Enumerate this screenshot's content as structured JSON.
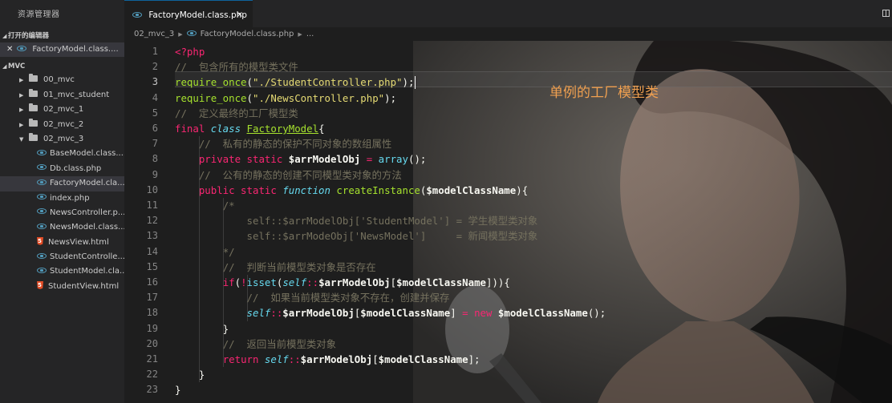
{
  "sidebar": {
    "title": "资源管理器",
    "open_editors": {
      "label": "打开的编辑器",
      "items": [
        {
          "name": "FactoryModel.class...."
        }
      ]
    },
    "workspace": {
      "label": "MVC",
      "folders": [
        {
          "name": "00_mvc"
        },
        {
          "name": "01_mvc_student"
        },
        {
          "name": "02_mvc_1"
        },
        {
          "name": "02_mvc_2"
        },
        {
          "name": "02_mvc_3"
        }
      ],
      "files": [
        {
          "name": "BaseModel.class....",
          "icon": "php-icon"
        },
        {
          "name": "Db.class.php",
          "icon": "php-icon"
        },
        {
          "name": "FactoryModel.cla...",
          "icon": "php-icon"
        },
        {
          "name": "index.php",
          "icon": "php-icon"
        },
        {
          "name": "NewsController.p...",
          "icon": "php-icon"
        },
        {
          "name": "NewsModel.class....",
          "icon": "php-icon"
        },
        {
          "name": "NewsView.html",
          "icon": "html-icon"
        },
        {
          "name": "StudentControlle...",
          "icon": "php-icon"
        },
        {
          "name": "StudentModel.cla...",
          "icon": "php-icon"
        },
        {
          "name": "StudentView.html",
          "icon": "html-icon"
        }
      ]
    }
  },
  "tab": {
    "label": "FactoryModel.class.php",
    "close": "×"
  },
  "breadcrumb": {
    "folder": "02_mvc_3",
    "file": "FactoryModel.class.php",
    "more": "..."
  },
  "annotation": "单例的工厂模型类",
  "line_numbers": [
    "1",
    "2",
    "3",
    "4",
    "5",
    "6",
    "7",
    "8",
    "9",
    "10",
    "11",
    "12",
    "13",
    "14",
    "15",
    "16",
    "17",
    "18",
    "19",
    "20",
    "21",
    "22",
    "23"
  ],
  "current_line": "3",
  "code_lines": [
    [
      {
        "c": "t-tag",
        "t": "<?php"
      }
    ],
    [
      {
        "c": "t-com",
        "t": "//  包含所有的模型类文件"
      }
    ],
    [
      {
        "c": "t-req",
        "t": "require_once"
      },
      {
        "c": "t-pun",
        "t": "("
      },
      {
        "c": "t-str",
        "t": "\"./StudentController.php\""
      },
      {
        "c": "t-pun",
        "t": ");"
      }
    ],
    [
      {
        "c": "t-req",
        "t": "require_once"
      },
      {
        "c": "t-pun",
        "t": "("
      },
      {
        "c": "t-str",
        "t": "\"./NewsController.php\""
      },
      {
        "c": "t-pun",
        "t": ");"
      }
    ],
    [
      {
        "c": "t-com",
        "t": "//  定义最终的工厂模型类"
      }
    ],
    [
      {
        "c": "t-kw",
        "t": "final "
      },
      {
        "c": "t-cls",
        "t": "class "
      },
      {
        "c": "t-def",
        "t": "FactoryModel"
      },
      {
        "c": "t-pun",
        "t": "{"
      }
    ],
    [
      {
        "c": "t-pun",
        "t": "    "
      },
      {
        "c": "t-com",
        "t": "//  私有的静态的保护不同对象的数组属性"
      }
    ],
    [
      {
        "c": "t-pun",
        "t": "    "
      },
      {
        "c": "t-kw",
        "t": "private static "
      },
      {
        "c": "t-var",
        "t": "$arrModelObj"
      },
      {
        "c": "t-op",
        "t": " = "
      },
      {
        "c": "t-blu",
        "t": "array"
      },
      {
        "c": "t-pun",
        "t": "();"
      }
    ],
    [
      {
        "c": "t-pun",
        "t": "    "
      },
      {
        "c": "t-com",
        "t": "//  公有的静态的创建不同模型类对象的方法"
      }
    ],
    [
      {
        "c": "t-pun",
        "t": "    "
      },
      {
        "c": "t-kw",
        "t": "public static "
      },
      {
        "c": "t-cls",
        "t": "function "
      },
      {
        "c": "t-fn",
        "t": "createInstance"
      },
      {
        "c": "t-pun",
        "t": "("
      },
      {
        "c": "t-var",
        "t": "$modelClassName"
      },
      {
        "c": "t-pun",
        "t": "){"
      }
    ],
    [
      {
        "c": "t-pun",
        "t": "        "
      },
      {
        "c": "t-com",
        "t": "/*"
      }
    ],
    [
      {
        "c": "t-pun",
        "t": "            "
      },
      {
        "c": "t-com",
        "t": "self::$arrModelObj['StudentModel'] = 学生模型类对象"
      }
    ],
    [
      {
        "c": "t-pun",
        "t": "            "
      },
      {
        "c": "t-com",
        "t": "self::$arrModeObj['NewsModel']     = 新闻模型类对象"
      }
    ],
    [
      {
        "c": "t-pun",
        "t": "        "
      },
      {
        "c": "t-com",
        "t": "*/"
      }
    ],
    [
      {
        "c": "t-pun",
        "t": "        "
      },
      {
        "c": "t-com",
        "t": "//  判断当前模型类对象是否存在"
      }
    ],
    [
      {
        "c": "t-pun",
        "t": "        "
      },
      {
        "c": "t-kw",
        "t": "if"
      },
      {
        "c": "t-pun",
        "t": "("
      },
      {
        "c": "t-op",
        "t": "!"
      },
      {
        "c": "t-blu",
        "t": "isset"
      },
      {
        "c": "t-pun",
        "t": "("
      },
      {
        "c": "t-self",
        "t": "self"
      },
      {
        "c": "t-op",
        "t": "::"
      },
      {
        "c": "t-var",
        "t": "$arrModelObj"
      },
      {
        "c": "t-pun",
        "t": "["
      },
      {
        "c": "t-var",
        "t": "$modelClassName"
      },
      {
        "c": "t-pun",
        "t": "])){"
      }
    ],
    [
      {
        "c": "t-pun",
        "t": "            "
      },
      {
        "c": "t-com",
        "t": "//  如果当前模型类对象不存在，创建并保存"
      }
    ],
    [
      {
        "c": "t-pun",
        "t": "            "
      },
      {
        "c": "t-self",
        "t": "self"
      },
      {
        "c": "t-op",
        "t": "::"
      },
      {
        "c": "t-var",
        "t": "$arrModelObj"
      },
      {
        "c": "t-pun",
        "t": "["
      },
      {
        "c": "t-var",
        "t": "$modelClassName"
      },
      {
        "c": "t-pun",
        "t": "]"
      },
      {
        "c": "t-op",
        "t": " = "
      },
      {
        "c": "t-kw",
        "t": "new "
      },
      {
        "c": "t-var",
        "t": "$modelClassName"
      },
      {
        "c": "t-pun",
        "t": "();"
      }
    ],
    [
      {
        "c": "t-pun",
        "t": "        }"
      }
    ],
    [
      {
        "c": "t-pun",
        "t": "        "
      },
      {
        "c": "t-com",
        "t": "//  返回当前模型类对象"
      }
    ],
    [
      {
        "c": "t-pun",
        "t": "        "
      },
      {
        "c": "t-kw",
        "t": "return "
      },
      {
        "c": "t-self",
        "t": "self"
      },
      {
        "c": "t-op",
        "t": "::"
      },
      {
        "c": "t-var",
        "t": "$arrModelObj"
      },
      {
        "c": "t-pun",
        "t": "["
      },
      {
        "c": "t-var",
        "t": "$modelClassName"
      },
      {
        "c": "t-pun",
        "t": "];"
      }
    ],
    [
      {
        "c": "t-pun",
        "t": "    }"
      }
    ],
    [
      {
        "c": "t-pun",
        "t": "}"
      }
    ]
  ]
}
